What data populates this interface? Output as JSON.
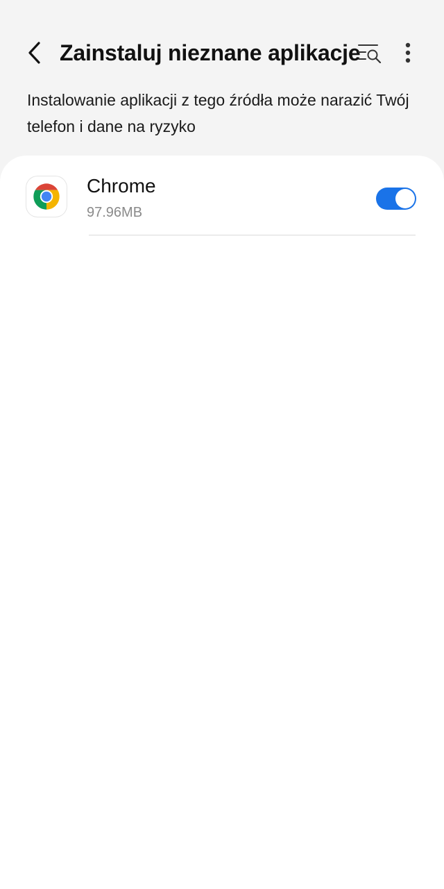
{
  "header": {
    "title": "Zainstaluj nieznane aplikacje",
    "back_icon": "chevron-left-icon",
    "search_icon": "list-search-icon",
    "more_icon": "more-vertical-icon"
  },
  "warning_text": "Instalowanie aplikacji z tego źródła może narazić Twój telefon i dane na ryzyko",
  "apps": [
    {
      "name": "Chrome",
      "size": "97.96MB",
      "icon": "chrome-icon",
      "allowed": true
    }
  ],
  "colors": {
    "background": "#f4f4f4",
    "card": "#ffffff",
    "accent": "#1a73e8",
    "secondary_text": "#8a8a8a"
  }
}
